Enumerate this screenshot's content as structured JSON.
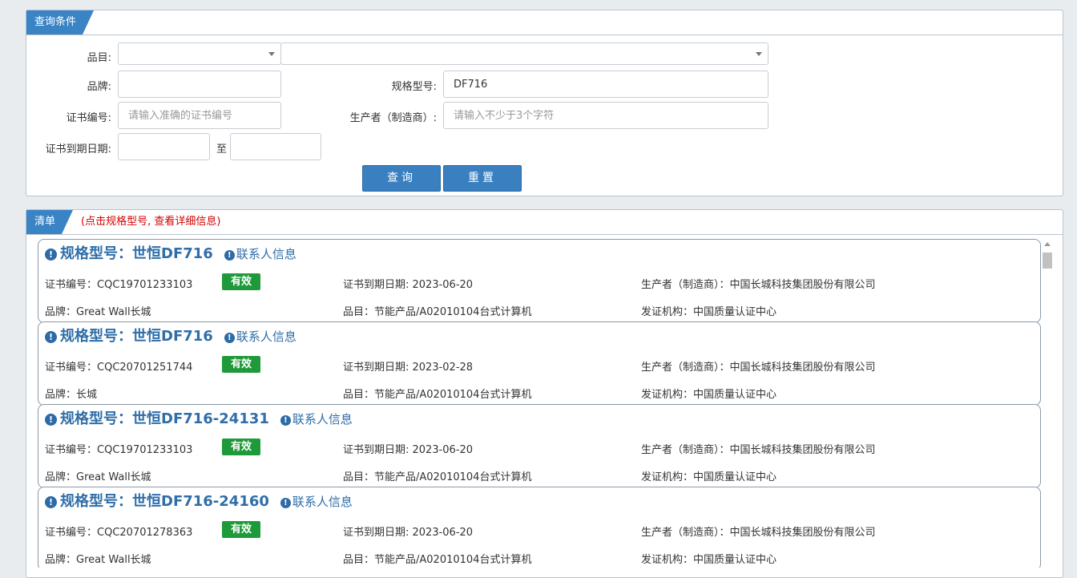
{
  "query": {
    "title": "查询条件",
    "labels": {
      "category": "品目:",
      "brand": "品牌:",
      "model": "规格型号:",
      "cert_no": "证书编号:",
      "producer": "生产者（制造商）:",
      "expiry": "证书到期日期:",
      "to": "至"
    },
    "values": {
      "model": "DF716"
    },
    "placeholders": {
      "cert_no": "请输入准确的证书编号",
      "producer": "请输入不少于3个字符"
    },
    "buttons": {
      "search": "查询",
      "reset": "重置"
    }
  },
  "list": {
    "title": "清单",
    "hint": "(点击规格型号, 查看详细信息)",
    "labels": {
      "cert_no": "证书编号：",
      "expiry": "证书到期日期: ",
      "producer": "生产者（制造商）：",
      "brand": "品牌：",
      "category": "品目：",
      "issuer": "发证机构：",
      "contact": "联系人信息",
      "model_prefix": "规格型号：",
      "status": "有效"
    },
    "items": [
      {
        "model": "世恒DF716",
        "cert_no": "CQC19701233103",
        "status": "有效",
        "expiry": "2023-06-20",
        "producer": "中国长城科技集团股份有限公司",
        "brand": "Great Wall长城",
        "category": "节能产品/A02010104台式计算机",
        "issuer": "中国质量认证中心"
      },
      {
        "model": "世恒DF716",
        "cert_no": "CQC20701251744",
        "status": "有效",
        "expiry": "2023-02-28",
        "producer": "中国长城科技集团股份有限公司",
        "brand": "长城",
        "category": "节能产品/A02010104台式计算机",
        "issuer": "中国质量认证中心"
      },
      {
        "model": "世恒DF716-24131",
        "cert_no": "CQC19701233103",
        "status": "有效",
        "expiry": "2023-06-20",
        "producer": "中国长城科技集团股份有限公司",
        "brand": "Great Wall长城",
        "category": "节能产品/A02010104台式计算机",
        "issuer": "中国质量认证中心"
      },
      {
        "model": "世恒DF716-24160",
        "cert_no": "CQC20701278363",
        "status": "有效",
        "expiry": "2023-06-20",
        "producer": "中国长城科技集团股份有限公司",
        "brand": "Great Wall长城",
        "category": "节能产品/A02010104台式计算机",
        "issuer": "中国质量认证中心"
      }
    ]
  },
  "icons": {
    "info": "exclamation-circle-icon",
    "dropdown": "caret-down-icon"
  },
  "colors": {
    "accent": "#3a84c6",
    "link": "#2f6ea8",
    "valid": "#1f9a3a",
    "hint": "#d40000"
  }
}
